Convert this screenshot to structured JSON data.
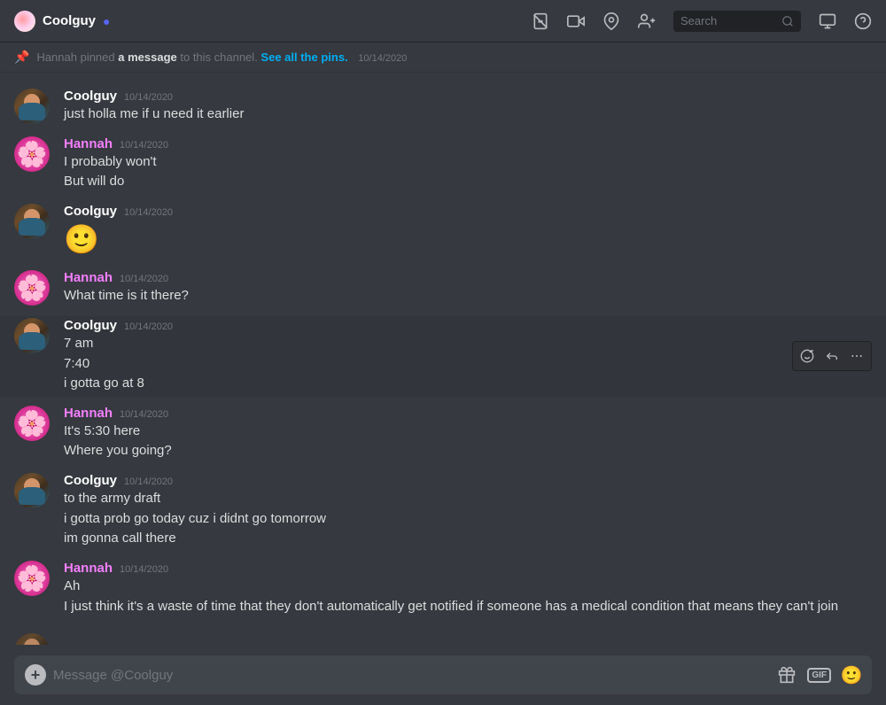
{
  "topbar": {
    "user_name": "Coolguy",
    "verified_symbol": "✓",
    "icons": [
      "📵",
      "📹",
      "⭐",
      "👤+",
      "🔍",
      "🖥",
      "❓"
    ],
    "search_placeholder": "Search"
  },
  "pinned": {
    "text_before": "Hannah pinned ",
    "link_text": "a message",
    "text_middle": " to this channel. ",
    "see_all_text": "See all the pins.",
    "timestamp": "10/14/2020"
  },
  "messages": [
    {
      "id": "msg1",
      "author": "Coolguy",
      "author_type": "coolguy",
      "timestamp": "10/14/2020",
      "lines": [
        "just holla me if u need it earlier"
      ]
    },
    {
      "id": "msg2",
      "author": "Hannah",
      "author_type": "hannah",
      "timestamp": "10/14/2020",
      "lines": [
        "I probably won't",
        "But will do"
      ]
    },
    {
      "id": "msg3",
      "author": "Coolguy",
      "author_type": "coolguy",
      "timestamp": "10/14/2020",
      "lines": [
        "🙂"
      ],
      "emoji": true
    },
    {
      "id": "msg4",
      "author": "Hannah",
      "author_type": "hannah",
      "timestamp": "10/14/2020",
      "lines": [
        "What time  is it there?"
      ]
    },
    {
      "id": "msg5",
      "author": "Coolguy",
      "author_type": "coolguy",
      "timestamp": "10/14/2020",
      "lines": [
        "7 am",
        "7:40",
        "i gotta go at 8"
      ],
      "hovered": true
    },
    {
      "id": "msg6",
      "author": "Hannah",
      "author_type": "hannah",
      "timestamp": "10/14/2020",
      "lines": [
        "It's 5:30 here",
        "Where you going?"
      ]
    },
    {
      "id": "msg7",
      "author": "Coolguy",
      "author_type": "coolguy",
      "timestamp": "10/14/2020",
      "lines": [
        "to the army draft",
        "i gotta prob go today cuz i didnt go tomorrow",
        "im gonna call there"
      ]
    },
    {
      "id": "msg8",
      "author": "Hannah",
      "author_type": "hannah",
      "timestamp": "10/14/2020",
      "lines": [
        "Ah",
        "I just think it's a waste of time that they don't automatically get notified if someone has a medical condition that means they can't join"
      ]
    }
  ],
  "input": {
    "placeholder": "Message @Coolguy",
    "gift_label": "GIF"
  },
  "actions": {
    "emoji_btn": "😊",
    "reply_btn": "↩",
    "more_btn": "⋯"
  }
}
